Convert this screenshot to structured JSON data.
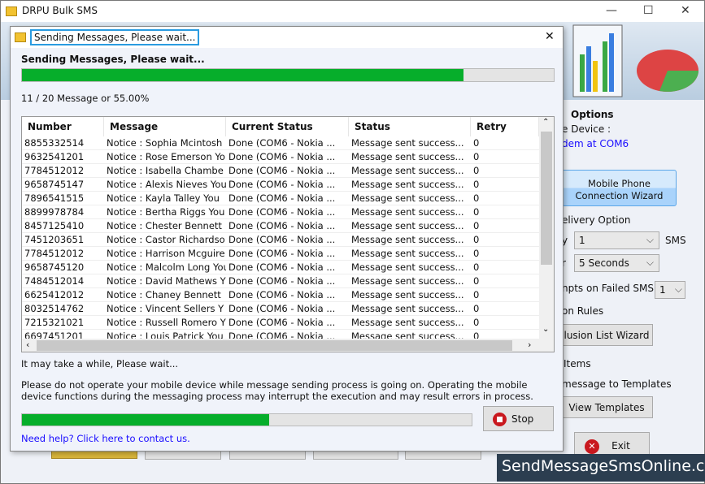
{
  "app": {
    "title": "DRPU Bulk SMS",
    "minimize": "—",
    "maximize": "☐",
    "close": "✕"
  },
  "right_panel": {
    "options_label": "Options",
    "device_label": "e Device :",
    "device_value": "dem at COM6",
    "wizard_line1": "Mobile Phone",
    "wizard_line2": "Connection  Wizard",
    "delivery_option": "elivery Option",
    "send_label": "y",
    "send_value": "1",
    "sms_label": "SMS",
    "delay_label": "r",
    "delay_value": "5  Seconds",
    "attempts_label": "npts on Failed SMS",
    "attempts_value": "1",
    "rules_label": "on Rules",
    "exclusion_button": "lusion List Wizard",
    "items_label": "Items",
    "templates_label": "message to Templates",
    "view_templates_button": "View Templates",
    "exit_button": "Exit"
  },
  "dialog": {
    "title": "Sending Messages, Please wait...",
    "heading": "Sending Messages, Please wait...",
    "close": "✕",
    "overall_progress_percent": 83,
    "count_text": "11 / 20 Message or 55.00%",
    "wait_text": "It may take a while, Please wait...",
    "warning_text": "Please do not operate your mobile device while message sending process is going on. Operating the mobile device functions during the messaging process may interrupt the execution and may result errors in process.",
    "message_progress_percent": 55,
    "stop_button": "Stop",
    "help_link": "Need help? Click here to contact us."
  },
  "table": {
    "columns": [
      "Number",
      "Message",
      "Current Status",
      "Status",
      "Retry"
    ],
    "rows": [
      [
        "8855332514",
        "Notice : Sophia Mcintosh",
        "Done (COM6 - Nokia ...",
        "Message sent success...",
        "0"
      ],
      [
        "9632541201",
        "Notice : Rose Emerson Yo",
        "Done (COM6 - Nokia ...",
        "Message sent success...",
        "0"
      ],
      [
        "7784512012",
        "Notice : Isabella Chambe",
        "Done (COM6 - Nokia ...",
        "Message sent success...",
        "0"
      ],
      [
        "9658745147",
        "Notice : Alexis Nieves You",
        "Done (COM6 - Nokia ...",
        "Message sent success...",
        "0"
      ],
      [
        "7896541515",
        "Notice : Kayla Talley You",
        "Done (COM6 - Nokia ...",
        "Message sent success...",
        "0"
      ],
      [
        "8899978784",
        "Notice : Bertha Riggs You",
        "Done (COM6 - Nokia ...",
        "Message sent success...",
        "0"
      ],
      [
        "8457125410",
        "Notice : Chester Bennett",
        "Done (COM6 - Nokia ...",
        "Message sent success...",
        "0"
      ],
      [
        "7451203651",
        "Notice : Castor Richardso",
        "Done (COM6 - Nokia ...",
        "Message sent success...",
        "0"
      ],
      [
        "7784512012",
        "Notice : Harrison Mcguire",
        "Done (COM6 - Nokia ...",
        "Message sent success...",
        "0"
      ],
      [
        "9658745120",
        "Notice : Malcolm Long You",
        "Done (COM6 - Nokia ...",
        "Message sent success...",
        "0"
      ],
      [
        "7484512014",
        "Notice : David Mathews Y",
        "Done (COM6 - Nokia ...",
        "Message sent success...",
        "0"
      ],
      [
        "6625412012",
        "Notice : Chaney Bennett",
        "Done (COM6 - Nokia ...",
        "Message sent success...",
        "0"
      ],
      [
        "8032514762",
        "Notice : Vincent Sellers Y",
        "Done (COM6 - Nokia ...",
        "Message sent success...",
        "0"
      ],
      [
        "7215321021",
        "Notice : Russell Romero Y",
        "Done (COM6 - Nokia ...",
        "Message sent success...",
        "0"
      ],
      [
        "6697451201",
        "Notice : Louis Patrick You",
        "Done (COM6 - Nokia ...",
        "Message sent success...",
        "0"
      ]
    ]
  },
  "watermark": "SendMessageSmsOnline.com",
  "colors": {
    "progress": "#06ae2b",
    "link": "#1a0dff",
    "accent": "#2a9be0"
  }
}
